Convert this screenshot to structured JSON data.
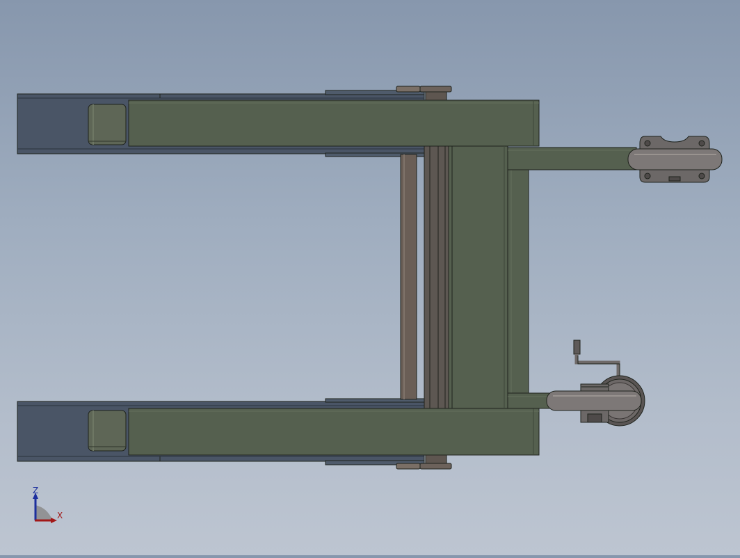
{
  "viewport": {
    "background_top": "#8797ad",
    "background_bottom": "#bdc5d1"
  },
  "model": {
    "colors": {
      "frame_green": "#55604f",
      "frame_green_dark": "#3d4639",
      "rail_blue": "#4a5566",
      "rail_blue_dark": "#333c48",
      "roller": "#5e6656",
      "bar_brown": "#6a5e56",
      "outline": "#1e221c",
      "wheel_gray": "#7d7877",
      "wheel_dark": "#4e4a49"
    }
  },
  "triad": {
    "z_label": "Z",
    "x_label": "X",
    "z_color": "#1c2f9e",
    "x_color": "#a21818",
    "y_color": "#8e8e8e"
  }
}
